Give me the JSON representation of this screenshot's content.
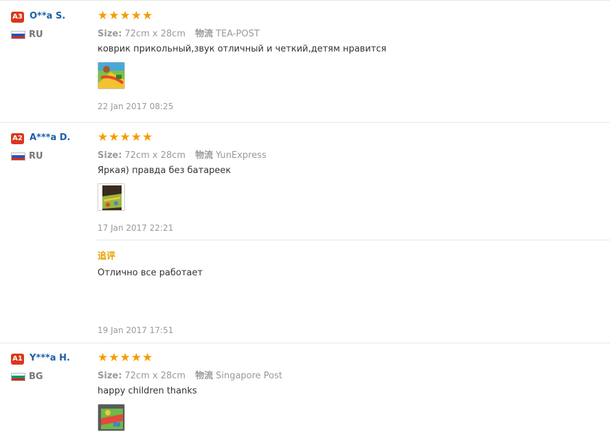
{
  "reviews": [
    {
      "level": "A3",
      "user": "O**a S.",
      "country": "RU",
      "stars": 5,
      "size_label": "Size:",
      "size": "72cm x 28cm",
      "logistics_label": "物流",
      "logistics": "TEA-POST",
      "feedback": "коврик прикольный,звук отличный и четкий,детям нравится",
      "date": "22 Jan 2017 08:25"
    },
    {
      "level": "A2",
      "user": "A***a D.",
      "country": "RU",
      "stars": 5,
      "size_label": "Size:",
      "size": "72cm x 28cm",
      "logistics_label": "物流",
      "logistics": "YunExpress",
      "feedback": "Яркая) правда без батареек",
      "date": "17 Jan 2017 22:21",
      "followup": {
        "title": "追评",
        "text": "Отлично все работает",
        "date": "19 Jan 2017 17:51"
      }
    },
    {
      "level": "A1",
      "user": "Y***a H.",
      "country": "BG",
      "stars": 5,
      "size_label": "Size:",
      "size": "72cm x 28cm",
      "logistics_label": "物流",
      "logistics": "Singapore Post",
      "feedback": "happy children thanks"
    }
  ],
  "colors": {
    "badge": "#d9371c",
    "name": "#1b5fa8",
    "star": "#f59b00",
    "followup_title": "#e8a000"
  }
}
